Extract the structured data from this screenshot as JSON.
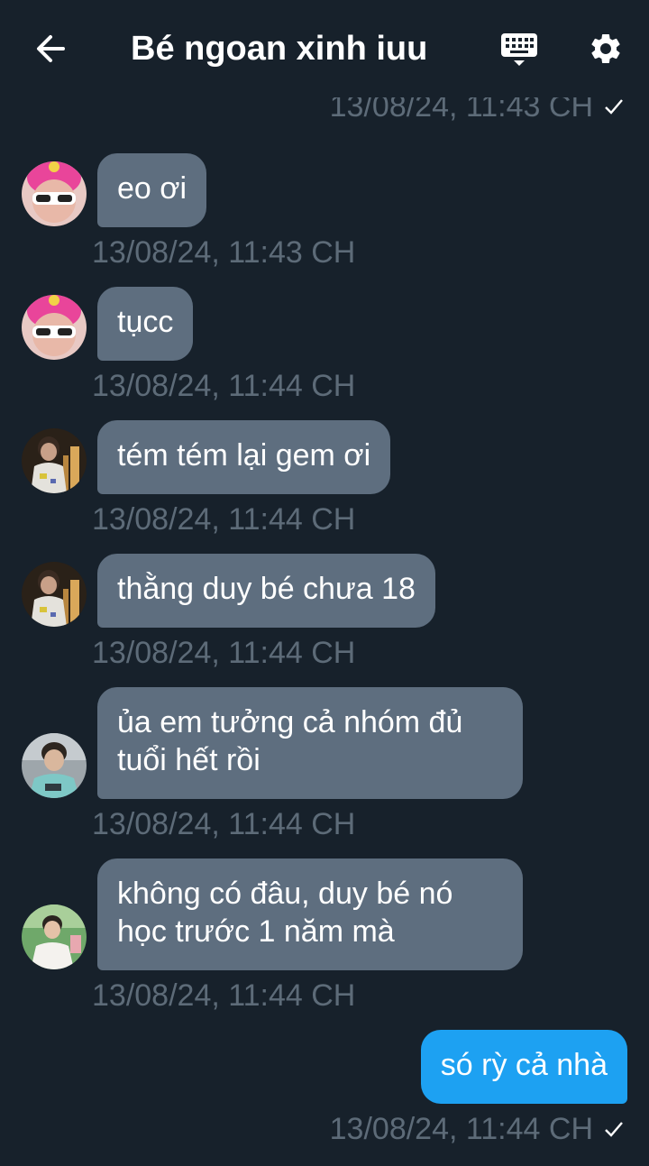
{
  "header": {
    "title": "Bé ngoan xinh iuu"
  },
  "top_timestamp": "13/08/24, 11:43 CH",
  "messages": [
    {
      "text": "eo ơi",
      "time": "13/08/24, 11:43 CH",
      "avatar": "pink-hair-avatar"
    },
    {
      "text": "tụcc",
      "time": "13/08/24, 11:44 CH",
      "avatar": "pink-hair-avatar"
    },
    {
      "text": "tém tém lại gem ơi",
      "time": "13/08/24, 11:44 CH",
      "avatar": "striped-shirt-avatar"
    },
    {
      "text": "thằng duy bé chưa 18",
      "time": "13/08/24, 11:44 CH",
      "avatar": "striped-shirt-avatar"
    },
    {
      "text": "ủa em tưởng cả nhóm đủ tuổi hết rồi",
      "time": "13/08/24, 11:44 CH",
      "avatar": "teal-shirt-avatar"
    },
    {
      "text": "không có đâu, duy bé nó học trước 1 năm mà",
      "time": "13/08/24, 11:44 CH",
      "avatar": "white-shirt-avatar"
    }
  ],
  "outgoing": {
    "text": "só rỳ cả nhà",
    "time": "13/08/24, 11:44 CH"
  },
  "colors": {
    "background": "#17212b",
    "incoming_bubble": "#5e6e7f",
    "outgoing_bubble": "#1da1f2",
    "timestamp": "#5d6b78"
  }
}
